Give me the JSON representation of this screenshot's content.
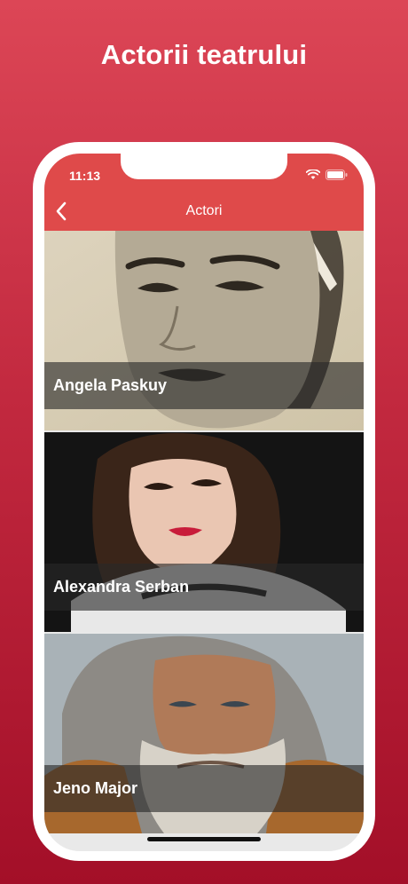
{
  "promo": {
    "title": "Actorii teatrului"
  },
  "status_bar": {
    "time": "11:13"
  },
  "nav": {
    "title": "Actori"
  },
  "actors": [
    {
      "name": "Angela Paskuy"
    },
    {
      "name": "Alexandra Serban"
    },
    {
      "name": "Jeno Major"
    }
  ],
  "colors": {
    "header": "#df4a4a",
    "background_top": "#dc4656",
    "background_bottom": "#a30f28"
  },
  "icons": [
    "back-chevron-icon",
    "wifi-icon",
    "battery-icon"
  ]
}
